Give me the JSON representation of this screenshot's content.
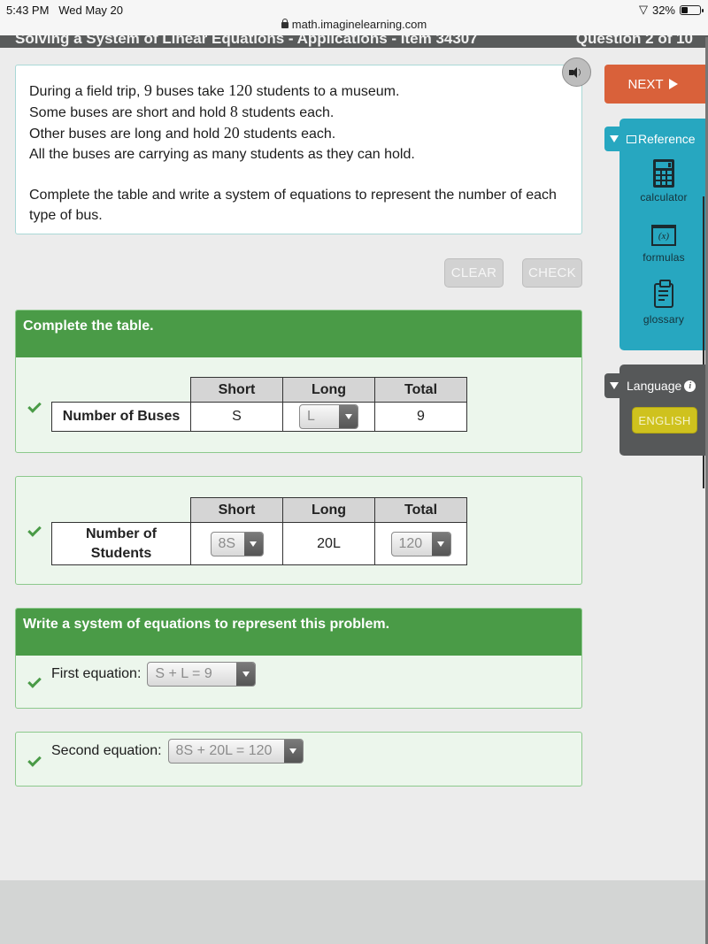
{
  "status_bar": {
    "time": "5:43 PM",
    "date": "Wed May 20",
    "battery": "32%",
    "url": "math.imaginelearning.com"
  },
  "header": {
    "title": "Solving a System of Linear Equations - Applications - Item 34307",
    "progress": "Question 2 of 10"
  },
  "prompt": {
    "line1": [
      "During a field trip, ",
      "9",
      " buses take ",
      "120",
      " students to a museum."
    ],
    "line2": [
      "Some buses are short and hold ",
      "8",
      " students each."
    ],
    "line3": [
      "Other buses are long and hold ",
      "20",
      " students each."
    ],
    "line4": "All the buses are carrying as many students as they can hold.",
    "instruction": "Complete the table and write a system of equations to represent the number of each type of bus."
  },
  "actions": {
    "clear": "CLEAR",
    "check": "CHECK",
    "next": "NEXT"
  },
  "reference": {
    "title": "Reference",
    "items": [
      {
        "label": "calculator",
        "icon": "calculator-icon"
      },
      {
        "label": "formulas",
        "icon": "formulas-icon"
      },
      {
        "label": "glossary",
        "icon": "glossary-icon"
      }
    ]
  },
  "language": {
    "title": "Language",
    "button": "ENGLISH"
  },
  "table_section": {
    "heading": "Complete the table.",
    "columns": [
      "Short",
      "Long",
      "Total"
    ],
    "buses_row": {
      "label": "Number of Buses",
      "short": "S",
      "long_dropdown": "L",
      "total": "9",
      "correct": true
    },
    "students_row": {
      "label_line1": "Number of",
      "label_line2": "Students",
      "short_dropdown": "8S",
      "long": "20L",
      "total_dropdown": "120",
      "correct": true
    }
  },
  "equations_section": {
    "heading": "Write a system of equations to represent this problem.",
    "first": {
      "label": "First equation:",
      "value": "S + L = 9",
      "correct": true
    },
    "second": {
      "label": "Second equation:",
      "value": "8S + 20L = 120",
      "correct": true
    }
  }
}
